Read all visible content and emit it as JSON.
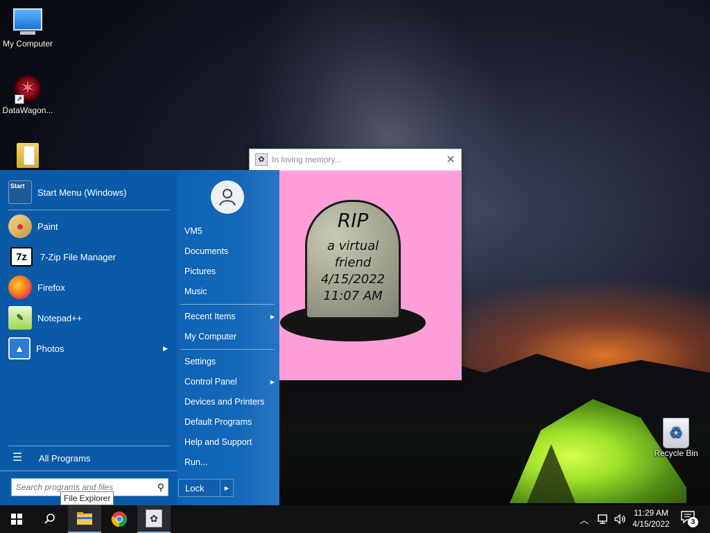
{
  "desktop": {
    "icons": [
      {
        "label": "My Computer"
      },
      {
        "label": "DataWagon..."
      },
      {
        "label": ""
      },
      {
        "label": "Recycle Bin"
      }
    ]
  },
  "popup": {
    "title": "In loving memory...",
    "close_glyph": "✕",
    "rip": "RIP",
    "epitaph_lines": [
      "a virtual",
      "friend",
      "4/15/2022",
      "11:07 AM"
    ],
    "bg_color": "#ff9ed8"
  },
  "start_menu": {
    "pinned": [
      {
        "label": "Start Menu (Windows)"
      },
      {
        "label": "Paint"
      },
      {
        "label": "7-Zip File Manager",
        "icon_text": "7z"
      },
      {
        "label": "Firefox"
      },
      {
        "label": "Notepad++"
      },
      {
        "label": "Photos",
        "has_submenu": true
      }
    ],
    "tile_text": "Start",
    "all_programs": "All Programs",
    "search_placeholder": "Search programs and files",
    "right_items": [
      {
        "label": "VM5"
      },
      {
        "label": "Documents"
      },
      {
        "label": "Pictures"
      },
      {
        "label": "Music"
      },
      {
        "label": "Recent Items",
        "has_submenu": true
      },
      {
        "label": "My Computer"
      },
      {
        "label": "Settings"
      },
      {
        "label": "Control Panel",
        "has_submenu": true
      },
      {
        "label": "Devices and Printers"
      },
      {
        "label": "Default Programs"
      },
      {
        "label": "Help and Support"
      },
      {
        "label": "Run..."
      }
    ],
    "lock_label": "Lock",
    "bg_color": "#0b58a6"
  },
  "tooltip": "File Explorer",
  "taskbar": {
    "clock_time": "11:29 AM",
    "clock_date": "4/15/2022",
    "notification_count": "3"
  }
}
